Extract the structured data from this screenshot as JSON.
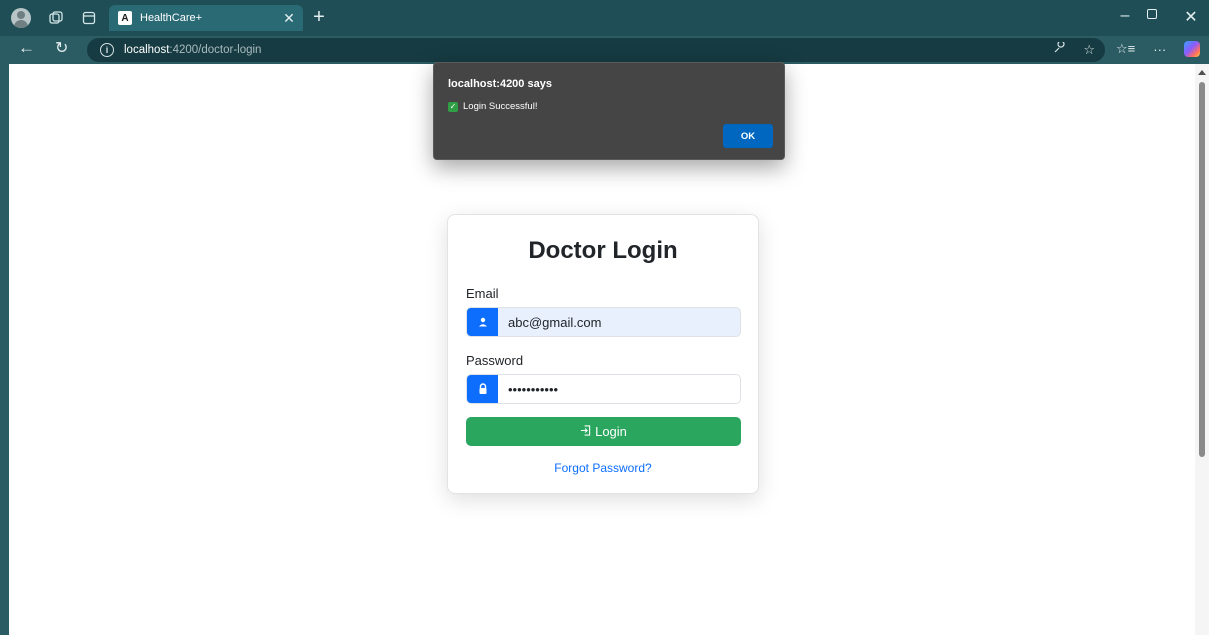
{
  "browser": {
    "tab_title": "HealthCare+",
    "tab_favicon": "A",
    "url_host": "localhost",
    "url_path": ":4200/doctor-login",
    "icons": [
      "profile-icon",
      "workspaces-icon",
      "tab-actions-icon",
      "close-icon",
      "plus-icon",
      "back-icon",
      "reload-icon",
      "info-icon",
      "read-aloud-icon",
      "favorite-icon",
      "favorites-icon",
      "more-icon",
      "copilot-icon"
    ]
  },
  "dialog": {
    "title": "localhost:4200 says",
    "message": "Login Successful!",
    "ok_label": "OK"
  },
  "login": {
    "title": "Doctor Login",
    "email_label": "Email",
    "email_value": "abc@gmail.com",
    "password_label": "Password",
    "password_value": "•••••••••••",
    "login_label": "Login",
    "forgot_label": "Forgot Password?"
  },
  "colors": {
    "primary": "#0d6efd",
    "success": "#2aa65f",
    "chrome": "#1f4e57",
    "dialog": "#454545"
  }
}
